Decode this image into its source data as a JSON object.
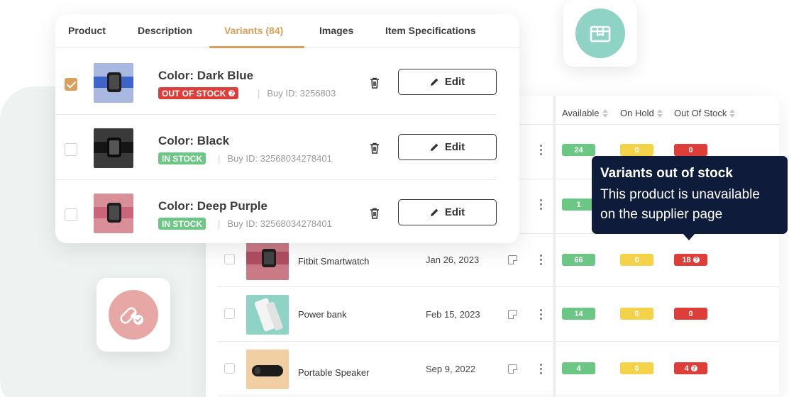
{
  "tabs": [
    {
      "label": "Product",
      "active": false
    },
    {
      "label": "Description",
      "active": false
    },
    {
      "label": "Variants (84)",
      "active": true
    },
    {
      "label": "Images",
      "active": false
    },
    {
      "label": "Item Specifications",
      "active": false
    }
  ],
  "variants": [
    {
      "title": "Color: Dark Blue",
      "status": "OUT OF STOCK",
      "buy_id": "Buy ID: 3256803",
      "checked": true,
      "edit_label": "Edit",
      "band_color": "#3f64c8"
    },
    {
      "title": "Color: Black",
      "status": "IN STOCK",
      "buy_id": "Buy ID: 32568034278401",
      "checked": false,
      "edit_label": "Edit",
      "band_color": "#1e1e1e"
    },
    {
      "title": "Color: Deep Purple",
      "status": "IN STOCK",
      "buy_id": "Buy ID: 32568034278401",
      "checked": false,
      "edit_label": "Edit",
      "band_color": "#c9647a"
    }
  ],
  "table": {
    "columns": [
      "Available",
      "On Hold",
      "Out Of Stock"
    ],
    "rows": [
      {
        "name": "",
        "date": "",
        "available": "24",
        "on_hold": "0",
        "out_of_stock": "0"
      },
      {
        "name": "",
        "date": "",
        "available": "1",
        "on_hold": "",
        "out_of_stock": ""
      },
      {
        "name": "Fitbit Smartwatch",
        "date": "Jan 26, 2023",
        "available": "66",
        "on_hold": "0",
        "out_of_stock": "18"
      },
      {
        "name": "Power bank",
        "date": "Feb 15, 2023",
        "available": "14",
        "on_hold": "0",
        "out_of_stock": "0"
      },
      {
        "name": "Portable Speaker",
        "date": "Sep 9, 2022",
        "available": "4",
        "on_hold": "0",
        "out_of_stock": "4"
      }
    ]
  },
  "tooltip": {
    "title": "Variants out of stock",
    "body_line1": "This product is unavailable",
    "body_line2": "on the supplier page"
  },
  "colors": {
    "accent": "#d9a05b",
    "in_stock": "#6cc785",
    "out_of_stock": "#dd3e3a",
    "on_hold": "#f4d34a",
    "tooltip_bg": "#0e1b3a",
    "teal_circle": "#8fd3c7",
    "pink_circle": "#e7a7a5"
  },
  "icons": [
    "package-icon",
    "link-check-icon",
    "trash-icon",
    "pencil-icon",
    "question-icon",
    "note-icon",
    "kebab-icon"
  ]
}
